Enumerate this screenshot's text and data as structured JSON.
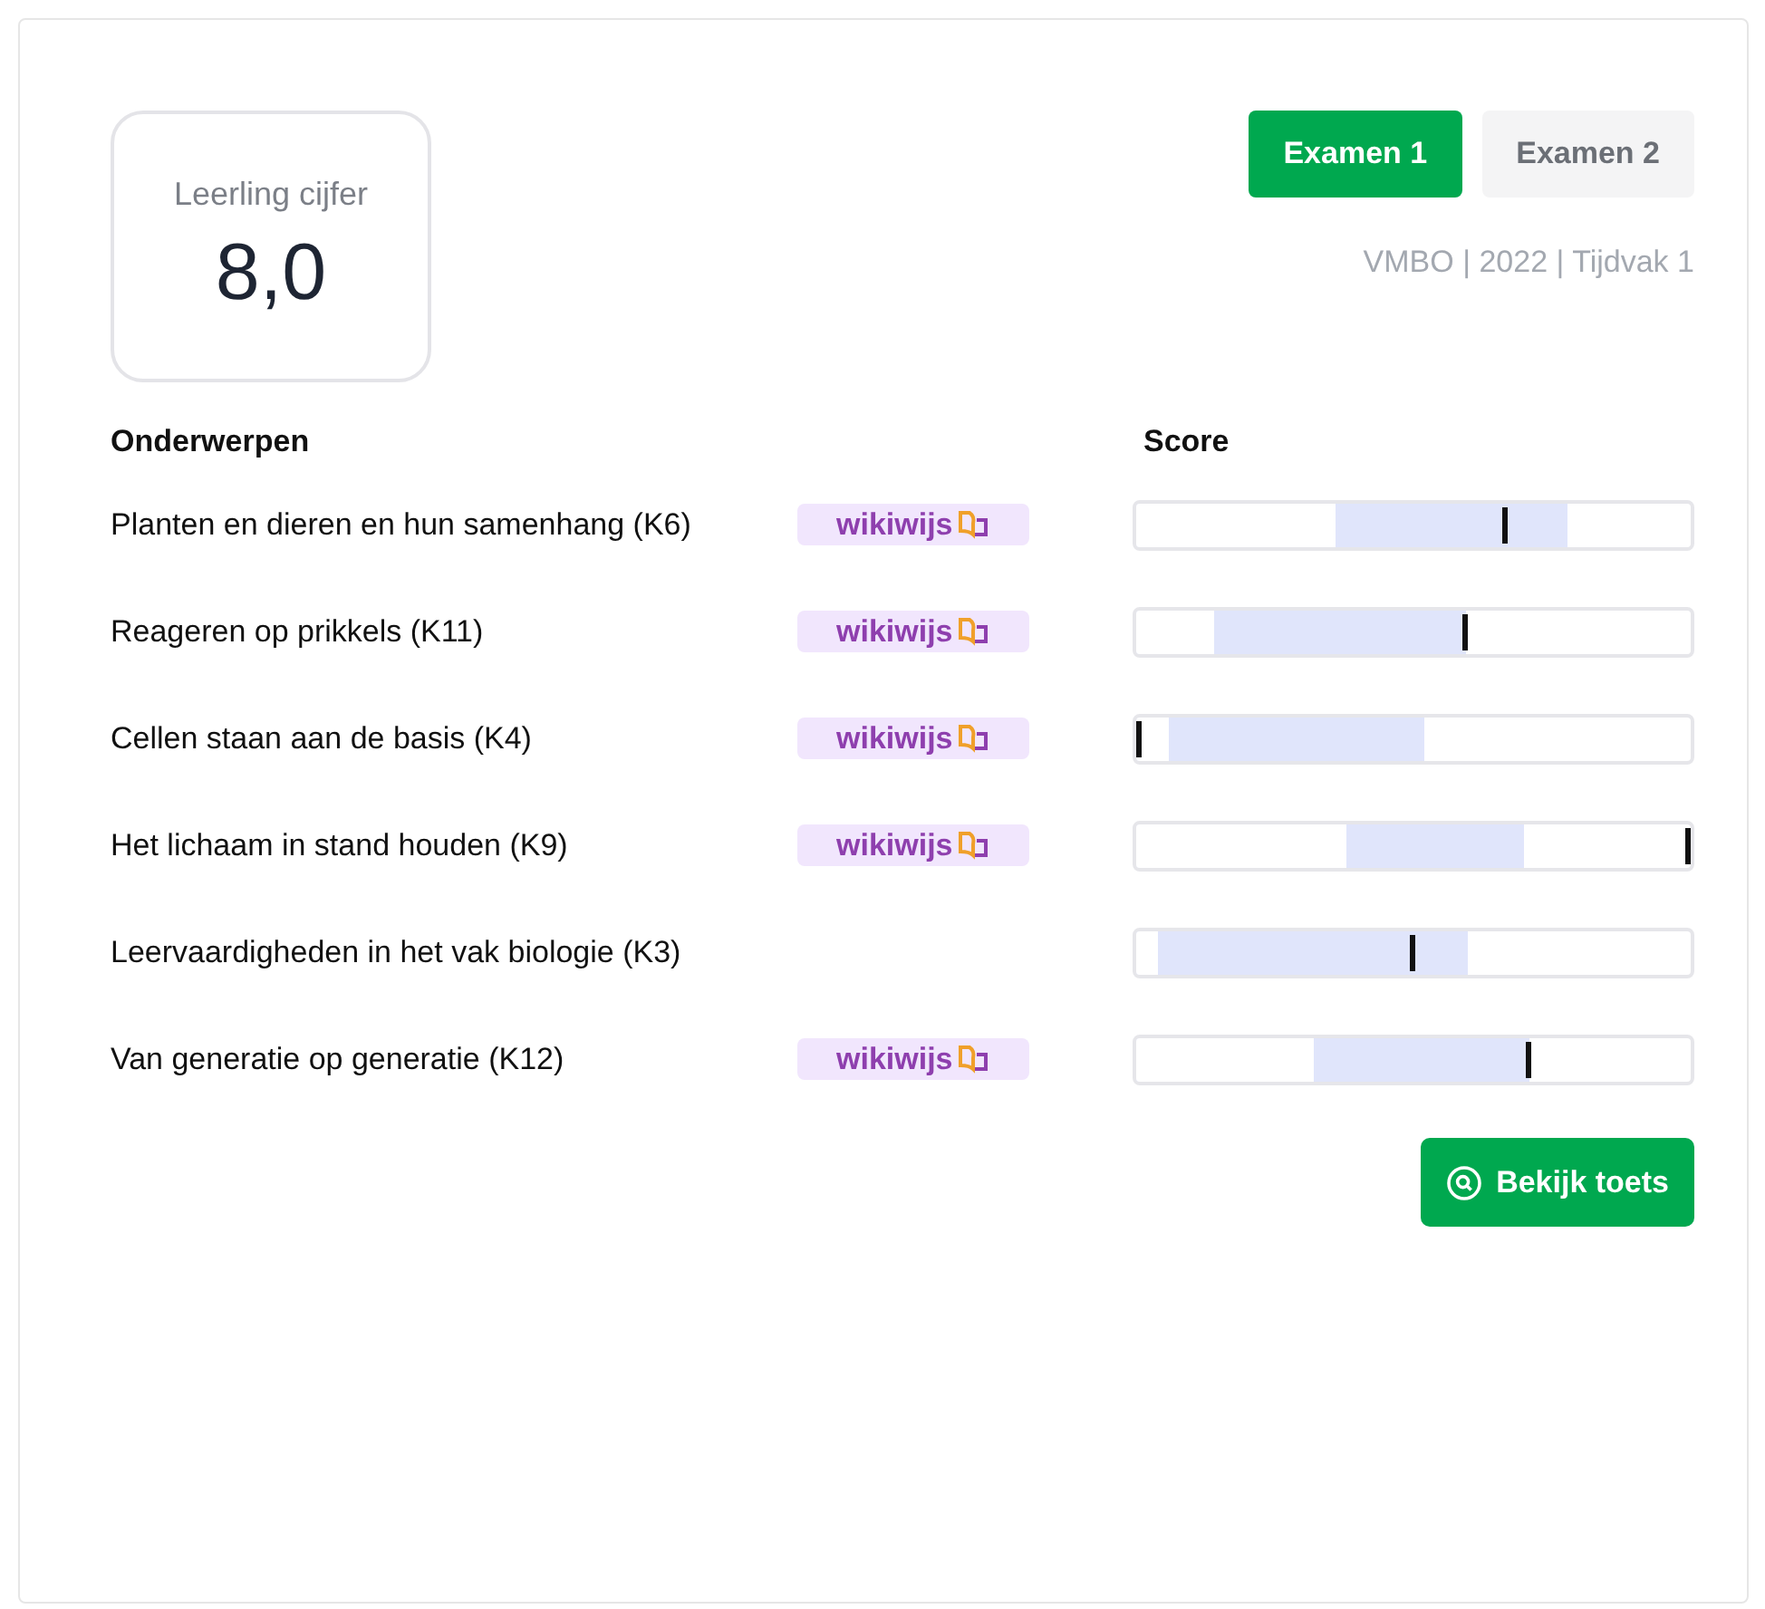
{
  "grade_card": {
    "label": "Leerling cijfer",
    "value": "8,0"
  },
  "exam_tabs": [
    {
      "label": "Examen 1",
      "selected": true
    },
    {
      "label": "Examen 2",
      "selected": false
    }
  ],
  "exam_info": "VMBO | 2022 | Tijdvak 1",
  "table": {
    "columns": [
      "Onderwerpen",
      "Score"
    ],
    "rows": [
      {
        "topic": "Planten en dieren en hun samenhang (K6)",
        "badge": "wikiwijs",
        "band_start": {
          "level": 0.36
        },
        "band_end": {
          "level": 0.777
        },
        "marker": {
          "level": 0.666
        }
      },
      {
        "topic": "Reageren op prikkels (K11)",
        "badge": "wikiwijs",
        "band_start": {
          "level": 0.143
        },
        "band_end": {
          "level": 0.596
        },
        "marker": {
          "level": 0.596
        }
      },
      {
        "topic": "Cellen staan aan de basis (K4)",
        "badge": "wikiwijs",
        "band_start": {
          "level": 0.06
        },
        "band_end": {
          "level": 0.52
        },
        "marker": {
          "level": 0.0
        }
      },
      {
        "topic": "Het lichaam in stand houden (K9)",
        "badge": "wikiwijs",
        "band_start": {
          "level": 0.38
        },
        "band_end": {
          "level": 0.7
        },
        "marker": {
          "level": 1.0
        }
      },
      {
        "topic": "Leervaardigheden in het vak biologie (K3)",
        "band_start": {
          "level": 0.04
        },
        "band_end": {
          "level": 0.6
        },
        "marker": {
          "level": 0.5
        }
      },
      {
        "topic": "Van generatie op generatie (K12)",
        "badge": "wikiwijs",
        "band_start": {
          "level": 0.32
        },
        "band_end": {
          "level": 0.71
        },
        "marker": {
          "level": 0.71
        }
      }
    ]
  },
  "action_button": "Bekijk toets"
}
